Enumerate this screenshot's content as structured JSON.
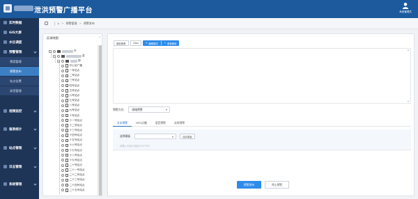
{
  "header": {
    "title": "泄洪预警广播平台",
    "user_label": "系统管理员"
  },
  "breadcrumb": {
    "parent": "预警管理",
    "current": "预警发布"
  },
  "sidebar": {
    "items": [
      {
        "label": "实时数据"
      },
      {
        "label": "GIS大屏"
      },
      {
        "label": "水位调度"
      },
      {
        "label": "预警管理",
        "expanded": true
      },
      {
        "label": "视频监控"
      },
      {
        "label": "报表统计"
      },
      {
        "label": "站点管理"
      },
      {
        "label": "日志管理"
      },
      {
        "label": "系统管理"
      }
    ],
    "sub_items": [
      {
        "label": "预案管理"
      },
      {
        "label": "预警发布",
        "active": true
      },
      {
        "label": "站点告警"
      },
      {
        "label": "录音管理"
      }
    ]
  },
  "tree": {
    "title": "区域地图",
    "collapse_glyph": "‹",
    "root_suffix": "市",
    "level2_suffix": "县",
    "level3_suffix": "镇",
    "nodes": [
      "中心站广播",
      "一号站点",
      "二号站点",
      "三号站点",
      "四号站点",
      "五号站点",
      "六号站点",
      "七号站点",
      "八号站点",
      "九号站点",
      "十号站点",
      "十一号站点",
      "十二号站点",
      "十三号站点",
      "十四号站点",
      "十五号站点",
      "十六号站点",
      "十七号站点",
      "十八号站点",
      "十九号站点",
      "二十号站点",
      "二十一号站点",
      "二十二号站点",
      "二十三号站点",
      "二十四号站点",
      "二十五号站点"
    ]
  },
  "toolbar": {
    "font_label": "微软雅黑",
    "size_label": "16px",
    "edit_label": "编辑模式",
    "voice_label": "语音朗读"
  },
  "mode": {
    "label": "预警方式:",
    "value": "网络预警"
  },
  "tabs": [
    "文本预警",
    "MP3点播",
    "语音预警",
    "实时预警"
  ],
  "text_tab": {
    "select_label": "选择模板",
    "save_label": "保存模板",
    "placeholder": "请输入内容(不超过500个字)"
  },
  "actions": {
    "publish": "预警发布",
    "stop": "停止预警"
  },
  "colors": {
    "header": "#1c5a9d",
    "sidebar": "#1e3558",
    "accent": "#2d8ceb",
    "active_sub": "#3d7fc4"
  }
}
